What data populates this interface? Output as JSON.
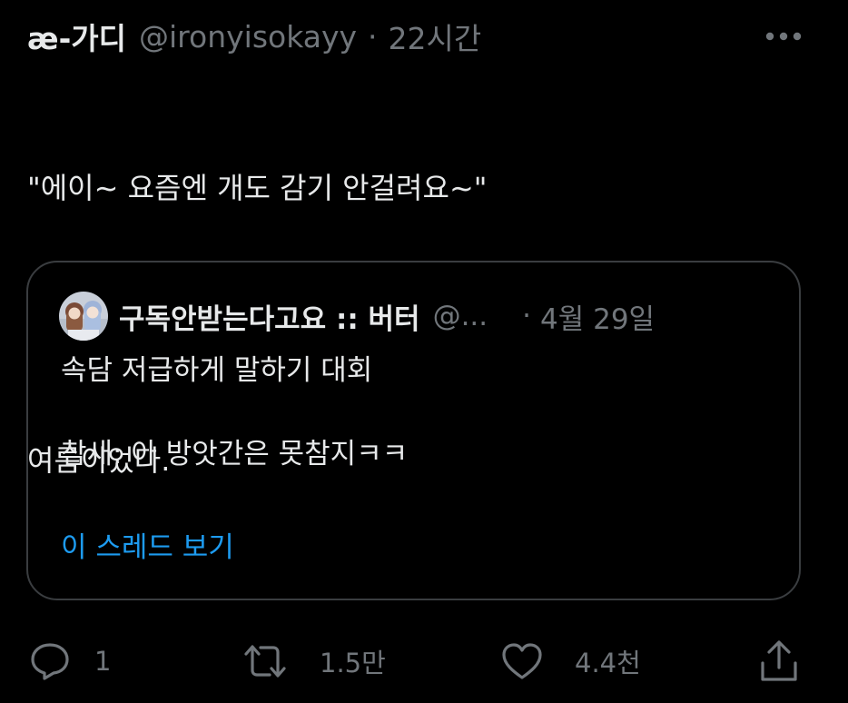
{
  "tweet": {
    "display_name": "æ-가디",
    "handle": "@ironyisokayy",
    "separator": "·",
    "time": "22시간",
    "body_lines": [
      "\"에이~ 요즘엔 개도 감기 안걸려요~\"",
      "",
      "여름이었다."
    ]
  },
  "quote": {
    "name": "구독안받는다고요 :: 버터",
    "handle": "@...",
    "separator": "·",
    "time": "4월 29일",
    "lines": [
      "속담 저급하게 말하기 대회",
      "",
      "참새: 아 방앗간은 못참지ㅋㅋ"
    ],
    "thread_link": "이 스레드 보기"
  },
  "actions": {
    "reply_count": "1",
    "retweet_count": "1.5만",
    "like_count": "4.4천"
  },
  "colors": {
    "background": "#000000",
    "text": "#e7e9ea",
    "secondary": "#71767b",
    "link": "#1d9bf0",
    "border": "#3a3d40"
  },
  "icons": [
    "more-icon",
    "avatar",
    "reply-icon",
    "retweet-icon",
    "like-icon",
    "share-icon"
  ]
}
